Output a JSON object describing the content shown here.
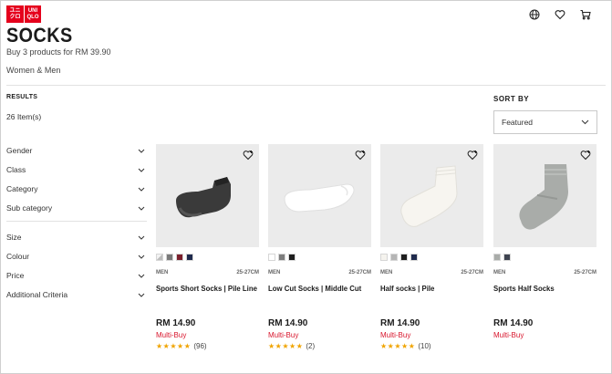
{
  "logo": {
    "line1_left": "ユニ",
    "line2_left": "クロ",
    "line1_right": "UNI",
    "line2_right": "QLO"
  },
  "header": {
    "title": "SOCKS",
    "subtitle": "Buy 3 products for RM 39.90",
    "tag": "Women & Men"
  },
  "icons": [
    "globe-icon",
    "heart-icon",
    "cart-icon"
  ],
  "results": {
    "label": "RESULTS",
    "count": "26 Item(s)"
  },
  "sort": {
    "label": "SORT BY",
    "selected": "Featured"
  },
  "filters_group1": [
    "Gender",
    "Class",
    "Category",
    "Sub category"
  ],
  "filters_group2": [
    "Size",
    "Colour",
    "Price",
    "Additional Criteria"
  ],
  "products": [
    {
      "name": "Sports Short Socks | Pile Line",
      "gender": "MEN",
      "size": "25-27CM",
      "price": "RM 14.90",
      "promo": "Multi-Buy",
      "stars": "★★★★★",
      "reviews": "(96)",
      "swatches": [
        "#f2f2f2",
        "#7a7a7a",
        "#7b1f2c",
        "#1f2a4d"
      ]
    },
    {
      "name": "Low Cut Socks | Middle Cut",
      "gender": "MEN",
      "size": "25-27CM",
      "price": "RM 14.90",
      "promo": "Multi-Buy",
      "stars": "★★★★★",
      "reviews": "(2)",
      "swatches": [
        "#ffffff",
        "#7d7d7d",
        "#1e1e1e"
      ]
    },
    {
      "name": "Half socks | Pile",
      "gender": "MEN",
      "size": "25-27CM",
      "price": "RM 14.90",
      "promo": "Multi-Buy",
      "stars": "★★★★★",
      "reviews": "(10)",
      "swatches": [
        "#f5f3ee",
        "#b5b5b5",
        "#1e1e1e",
        "#1f2a4d"
      ]
    },
    {
      "name": "Sports Half Socks",
      "gender": "MEN",
      "size": "25-27CM",
      "price": "RM 14.90",
      "promo": "Multi-Buy",
      "stars": "",
      "reviews": "",
      "swatches": [
        "#a9aca9",
        "#3e4350"
      ]
    }
  ],
  "colors": {
    "brand_red": "#e5001c",
    "promo_red": "#d8152c",
    "star": "#f0a400"
  }
}
